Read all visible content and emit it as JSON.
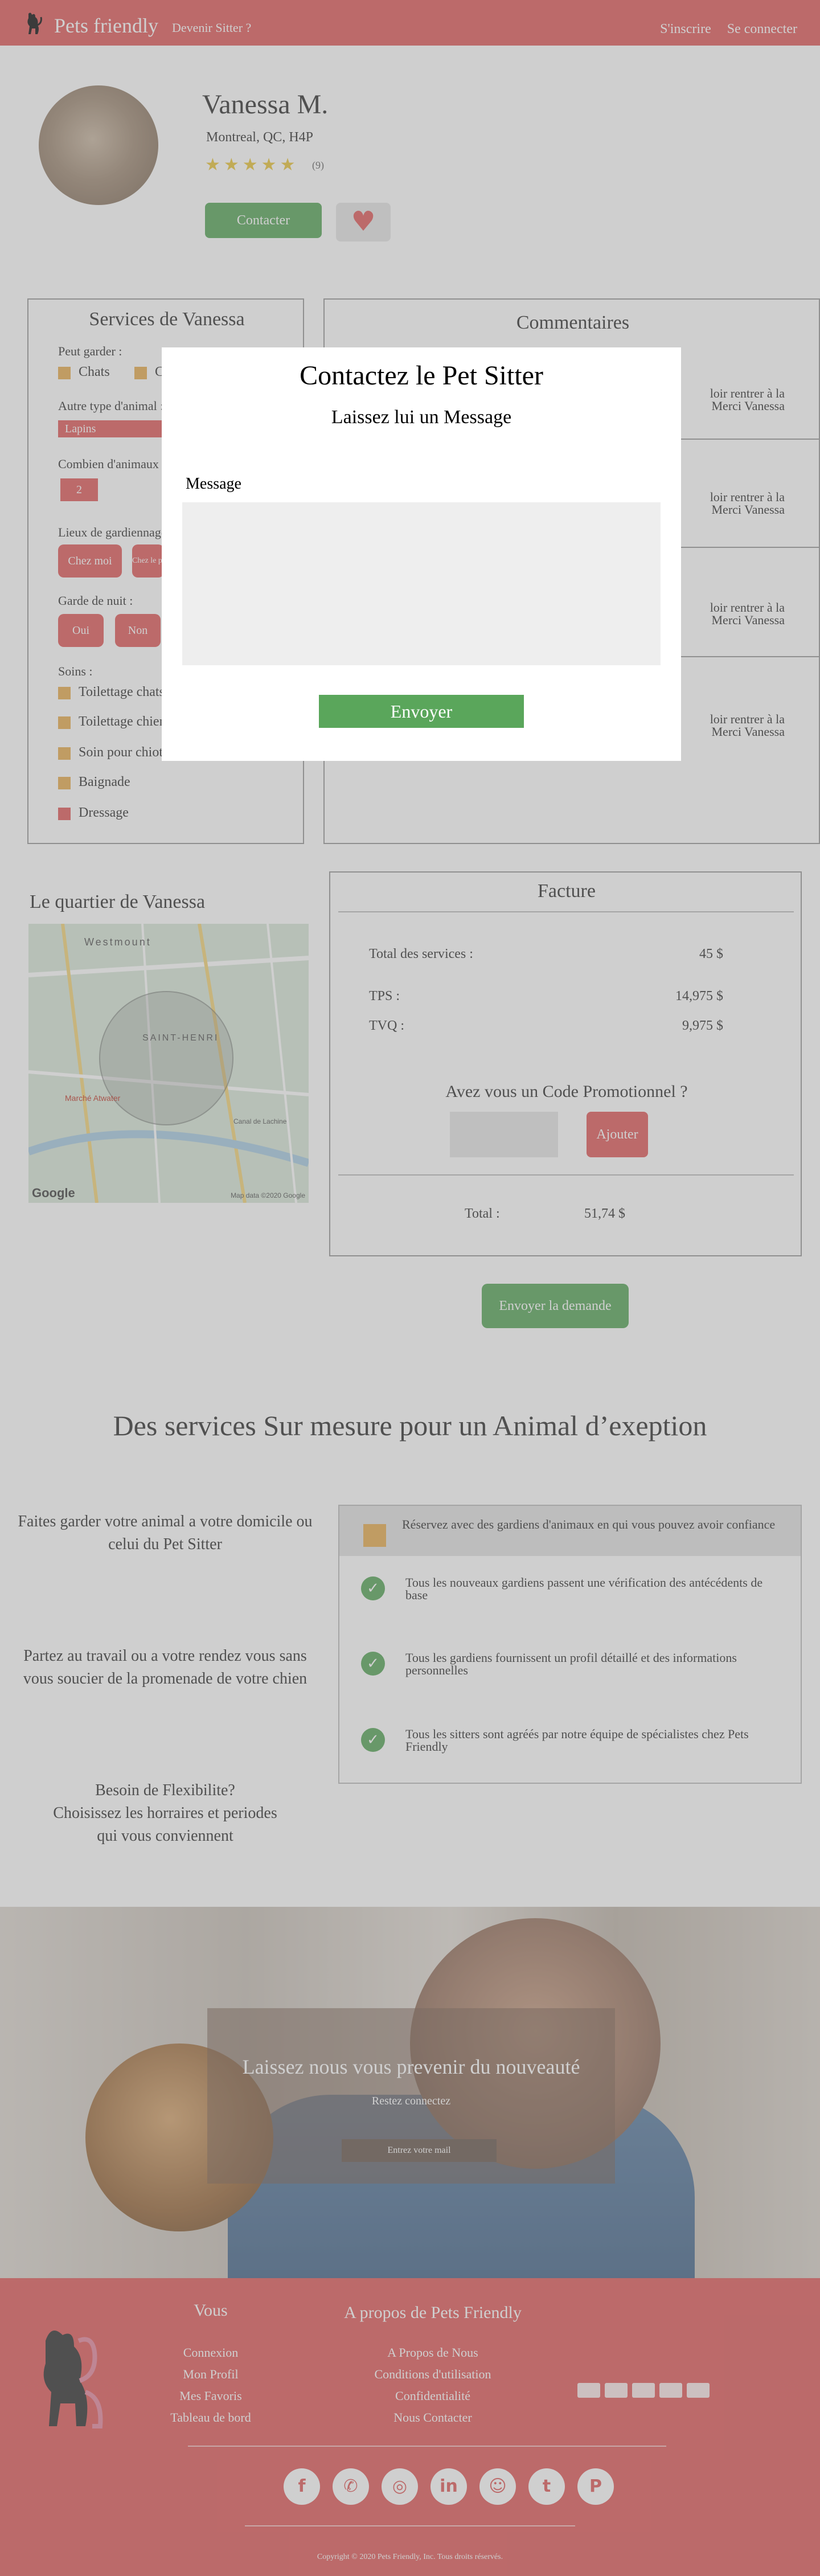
{
  "header": {
    "brand": "Pets friendly",
    "become_sitter": "Devenir Sitter ?",
    "signup": "S'inscrire",
    "login": "Se connecter"
  },
  "profile": {
    "name": "Vanessa M.",
    "location": "Montreal, QC, H4P",
    "stars": "★★★★★",
    "rating": 5,
    "review_count": "(9)",
    "contact_label": "Contacter",
    "favorite_icon": "heart-icon"
  },
  "services": {
    "title": "Services de Vanessa",
    "can_keep_label": "Peut garder :",
    "animals": [
      "Chats",
      "Chiens"
    ],
    "other_animal_label": "Autre type d'animal :",
    "other_animal_value": "Lapins",
    "count_label": "Combien d'animaux :",
    "count_value": "2",
    "places_label": "Lieux de gardiennage :",
    "places": [
      "Chez moi",
      "Chez le propriétaire"
    ],
    "night_label": "Garde de nuit :",
    "night_options": [
      "Oui",
      "Non"
    ],
    "care_label": "Soins :",
    "care_items": [
      "Toilettage chats",
      "Toilettage chiens",
      "Soin pour chiots",
      "Baignade",
      "Dressage"
    ]
  },
  "comments": {
    "title": "Commentaires",
    "items": [
      {
        "line1": "loir rentrer à la",
        "line2": "Merci Vanessa"
      },
      {
        "line1": "loir rentrer à la",
        "line2": "Merci Vanessa"
      },
      {
        "line1": "loir rentrer à la",
        "line2": "Merci Vanessa"
      },
      {
        "line1": "loir rentrer à la",
        "line2": "Merci Vanessa"
      }
    ]
  },
  "neighborhood": {
    "title": "Le quartier de Vanessa",
    "map_label_top": "Westmount",
    "map_label_center": "SAINT-HENRI",
    "map_label_place": "Marché Atwater",
    "map_label_river": "Canal de Lachine",
    "google": "Google",
    "map_credit": "Map data ©2020 Google"
  },
  "invoice": {
    "title": "Facture",
    "total_services_label": "Total des services :",
    "total_services_value": "45 $",
    "tps_label": "TPS :",
    "tps_value": "14,975 $",
    "tvq_label": "TVQ :",
    "tvq_value": "9,975 $",
    "promo_title": "Avez vous un Code Promotionnel ?",
    "promo_button": "Ajouter",
    "total_label": "Total :",
    "total_value": "51,74 $",
    "send_request": "Envoyer la demande"
  },
  "features": {
    "title": "Des services Sur mesure pour un Animal d’exeption",
    "feature_1": "Faites garder votre animal a votre domicile ou celui du Pet Sitter",
    "feature_2": "Partez au travail ou a votre rendez vous sans vous soucier de la promenade de votre chien",
    "feature_3_line1": "Besoin de Flexibilite?",
    "feature_3_line2": "Choisissez les horraires et periodes",
    "feature_3_line3": "qui vous conviennent",
    "trust_head": "Réservez avec des gardiens d'animaux en qui vous pouvez avoir confiance",
    "trust_items": [
      "Tous les nouveaux gardiens passent une vérification des antécédents de base",
      "Tous les gardiens fournissent un profil détaillé et des informations personnelles",
      "Tous les sitters sont agréés par notre équipe de spécialistes chez Pets Friendly"
    ]
  },
  "hero": {
    "title": "Laissez nous vous prevenir du nouveauté",
    "subtitle": "Restez connectez",
    "button": "Entrez votre mail"
  },
  "footer": {
    "col1_title": "Vous",
    "col1_links": [
      "Connexion",
      "Mon Profil",
      "Mes Favoris",
      "Tableau de bord"
    ],
    "col2_title": "A propos de Pets Friendly",
    "col2_links": [
      "A Propos de Nous",
      "Conditions d'utilisation",
      "Confidentialité",
      "Nous Contacter"
    ],
    "social_icons": [
      "facebook-icon",
      "whatsapp-icon",
      "instagram-icon",
      "linkedin-icon",
      "snapchat-icon",
      "twitter-icon",
      "pinterest-icon"
    ],
    "copyright": "Copyright © 2020 Pets Friendly, Inc. Tous droits réservés."
  },
  "modal": {
    "title": "Contactez le Pet Sitter",
    "subtitle": "Laissez lui un Message",
    "message_label": "Message",
    "message_value": "",
    "send_label": "Envoyer"
  }
}
